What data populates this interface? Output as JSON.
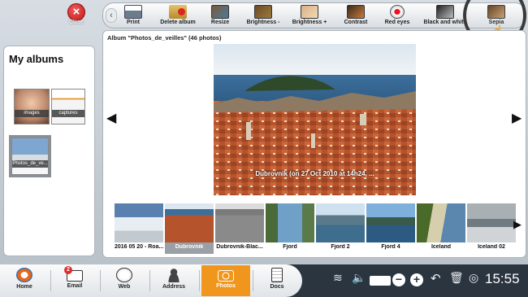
{
  "toolbar": {
    "close_label": "Close",
    "back_label": "‹",
    "items": [
      {
        "label": "Print"
      },
      {
        "label": "Delete album"
      },
      {
        "label": "Resize"
      },
      {
        "label": "Brightness -"
      },
      {
        "label": "Brightness +"
      },
      {
        "label": "Contrast"
      },
      {
        "label": "Red eyes"
      },
      {
        "label": "Black and white"
      },
      {
        "label": "Sepia"
      }
    ]
  },
  "albums": {
    "title": "My albums",
    "items": [
      {
        "label": "images"
      },
      {
        "label": "captures"
      },
      {
        "label": "Photos_de_ve..."
      }
    ]
  },
  "viewer": {
    "header": "Album \"Photos_de_veilles\" (46 photos)",
    "photo_caption": "Dubrovnik (on 27 Oct 2010 at 14h24, ...",
    "prev_arrow": "◀",
    "next_arrow": "▶",
    "thumbs_next_arrow": "▶",
    "thumbnails": [
      {
        "label": "2016 05 20 - Roa..."
      },
      {
        "label": "Dubrovnik"
      },
      {
        "label": "Dubrovnik-Blac..."
      },
      {
        "label": "Fjord"
      },
      {
        "label": "Fjord 2"
      },
      {
        "label": "Fjord 4"
      },
      {
        "label": "Iceland"
      },
      {
        "label": "Iceland 02"
      }
    ]
  },
  "dock": {
    "items": [
      {
        "label": "Home"
      },
      {
        "label": "Email",
        "badge": "2"
      },
      {
        "label": "Web"
      },
      {
        "label": "Address"
      },
      {
        "label": "Photos"
      },
      {
        "label": "Docs"
      }
    ],
    "clock": "15:55",
    "tray": {
      "wifi": "≋",
      "volume": "🔈",
      "minus": "−",
      "plus": "+",
      "trash": "🗑",
      "help": "◎"
    }
  },
  "colors": {
    "accent_orange": "#f0961c",
    "close_red": "#d42020",
    "dock_dark": "#2b3540"
  }
}
